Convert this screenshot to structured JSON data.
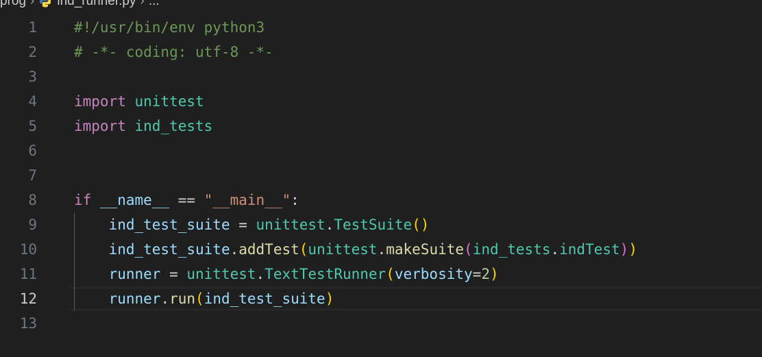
{
  "breadcrumb": {
    "folder": "prog",
    "file": "ind_runner.py",
    "tail": "..."
  },
  "icons": {
    "separator": "chevron-right-icon",
    "file": "python-file-icon"
  },
  "colors": {
    "background": "#1f1f1f",
    "line_number": "#6e7681",
    "active_line_number": "#cccccc",
    "comment": "#6a9955",
    "keyword": "#c586c0",
    "variable": "#9cdcfe",
    "module": "#4ec9b0",
    "function": "#dcdcaa",
    "string": "#ce9178",
    "number": "#b5cea8",
    "bracket_level1": "#ffd700",
    "bracket_level2": "#da70d6",
    "bracket_level3": "#179fff"
  },
  "editor": {
    "active_line": "12",
    "lines": [
      {
        "num": "1",
        "tokens": [
          {
            "t": "#!/usr/bin/env python3",
            "c": "c"
          }
        ]
      },
      {
        "num": "2",
        "tokens": [
          {
            "t": "# -*- coding: utf-8 -*-",
            "c": "c"
          }
        ]
      },
      {
        "num": "3",
        "tokens": []
      },
      {
        "num": "4",
        "tokens": [
          {
            "t": "import",
            "c": "k"
          },
          {
            "t": " ",
            "c": ""
          },
          {
            "t": "unittest",
            "c": "m"
          }
        ]
      },
      {
        "num": "5",
        "tokens": [
          {
            "t": "import",
            "c": "k"
          },
          {
            "t": " ",
            "c": ""
          },
          {
            "t": "ind_tests",
            "c": "m"
          }
        ]
      },
      {
        "num": "6",
        "tokens": []
      },
      {
        "num": "7",
        "tokens": []
      },
      {
        "num": "8",
        "tokens": [
          {
            "t": "if",
            "c": "k"
          },
          {
            "t": " ",
            "c": ""
          },
          {
            "t": "__name__",
            "c": "v"
          },
          {
            "t": " == ",
            "c": "o"
          },
          {
            "t": "\"__main__\"",
            "c": "s"
          },
          {
            "t": ":",
            "c": "o"
          }
        ]
      },
      {
        "num": "9",
        "tokens": [
          {
            "t": "    ",
            "c": ""
          },
          {
            "t": "ind_test_suite",
            "c": "v"
          },
          {
            "t": " = ",
            "c": "o"
          },
          {
            "t": "unittest",
            "c": "m"
          },
          {
            "t": ".",
            "c": "o"
          },
          {
            "t": "TestSuite",
            "c": "m"
          },
          {
            "t": "()",
            "c": "b1"
          }
        ]
      },
      {
        "num": "10",
        "tokens": [
          {
            "t": "    ",
            "c": ""
          },
          {
            "t": "ind_test_suite",
            "c": "v"
          },
          {
            "t": ".",
            "c": "o"
          },
          {
            "t": "addTest",
            "c": "f"
          },
          {
            "t": "(",
            "c": "b1"
          },
          {
            "t": "unittest",
            "c": "m"
          },
          {
            "t": ".",
            "c": "o"
          },
          {
            "t": "makeSuite",
            "c": "f"
          },
          {
            "t": "(",
            "c": "b2"
          },
          {
            "t": "ind_tests",
            "c": "m"
          },
          {
            "t": ".",
            "c": "o"
          },
          {
            "t": "indTest",
            "c": "m"
          },
          {
            "t": ")",
            "c": "b2"
          },
          {
            "t": ")",
            "c": "b1"
          }
        ]
      },
      {
        "num": "11",
        "tokens": [
          {
            "t": "    ",
            "c": ""
          },
          {
            "t": "runner",
            "c": "v"
          },
          {
            "t": " = ",
            "c": "o"
          },
          {
            "t": "unittest",
            "c": "m"
          },
          {
            "t": ".",
            "c": "o"
          },
          {
            "t": "TextTestRunner",
            "c": "m"
          },
          {
            "t": "(",
            "c": "b1"
          },
          {
            "t": "verbosity",
            "c": "v"
          },
          {
            "t": "=",
            "c": "o"
          },
          {
            "t": "2",
            "c": "n"
          },
          {
            "t": ")",
            "c": "b1"
          }
        ]
      },
      {
        "num": "12",
        "tokens": [
          {
            "t": "    ",
            "c": ""
          },
          {
            "t": "runner",
            "c": "v"
          },
          {
            "t": ".",
            "c": "o"
          },
          {
            "t": "run",
            "c": "f"
          },
          {
            "t": "(",
            "c": "b1"
          },
          {
            "t": "ind_test_suite",
            "c": "v"
          },
          {
            "t": ")",
            "c": "b1"
          }
        ]
      },
      {
        "num": "13",
        "tokens": []
      }
    ]
  }
}
